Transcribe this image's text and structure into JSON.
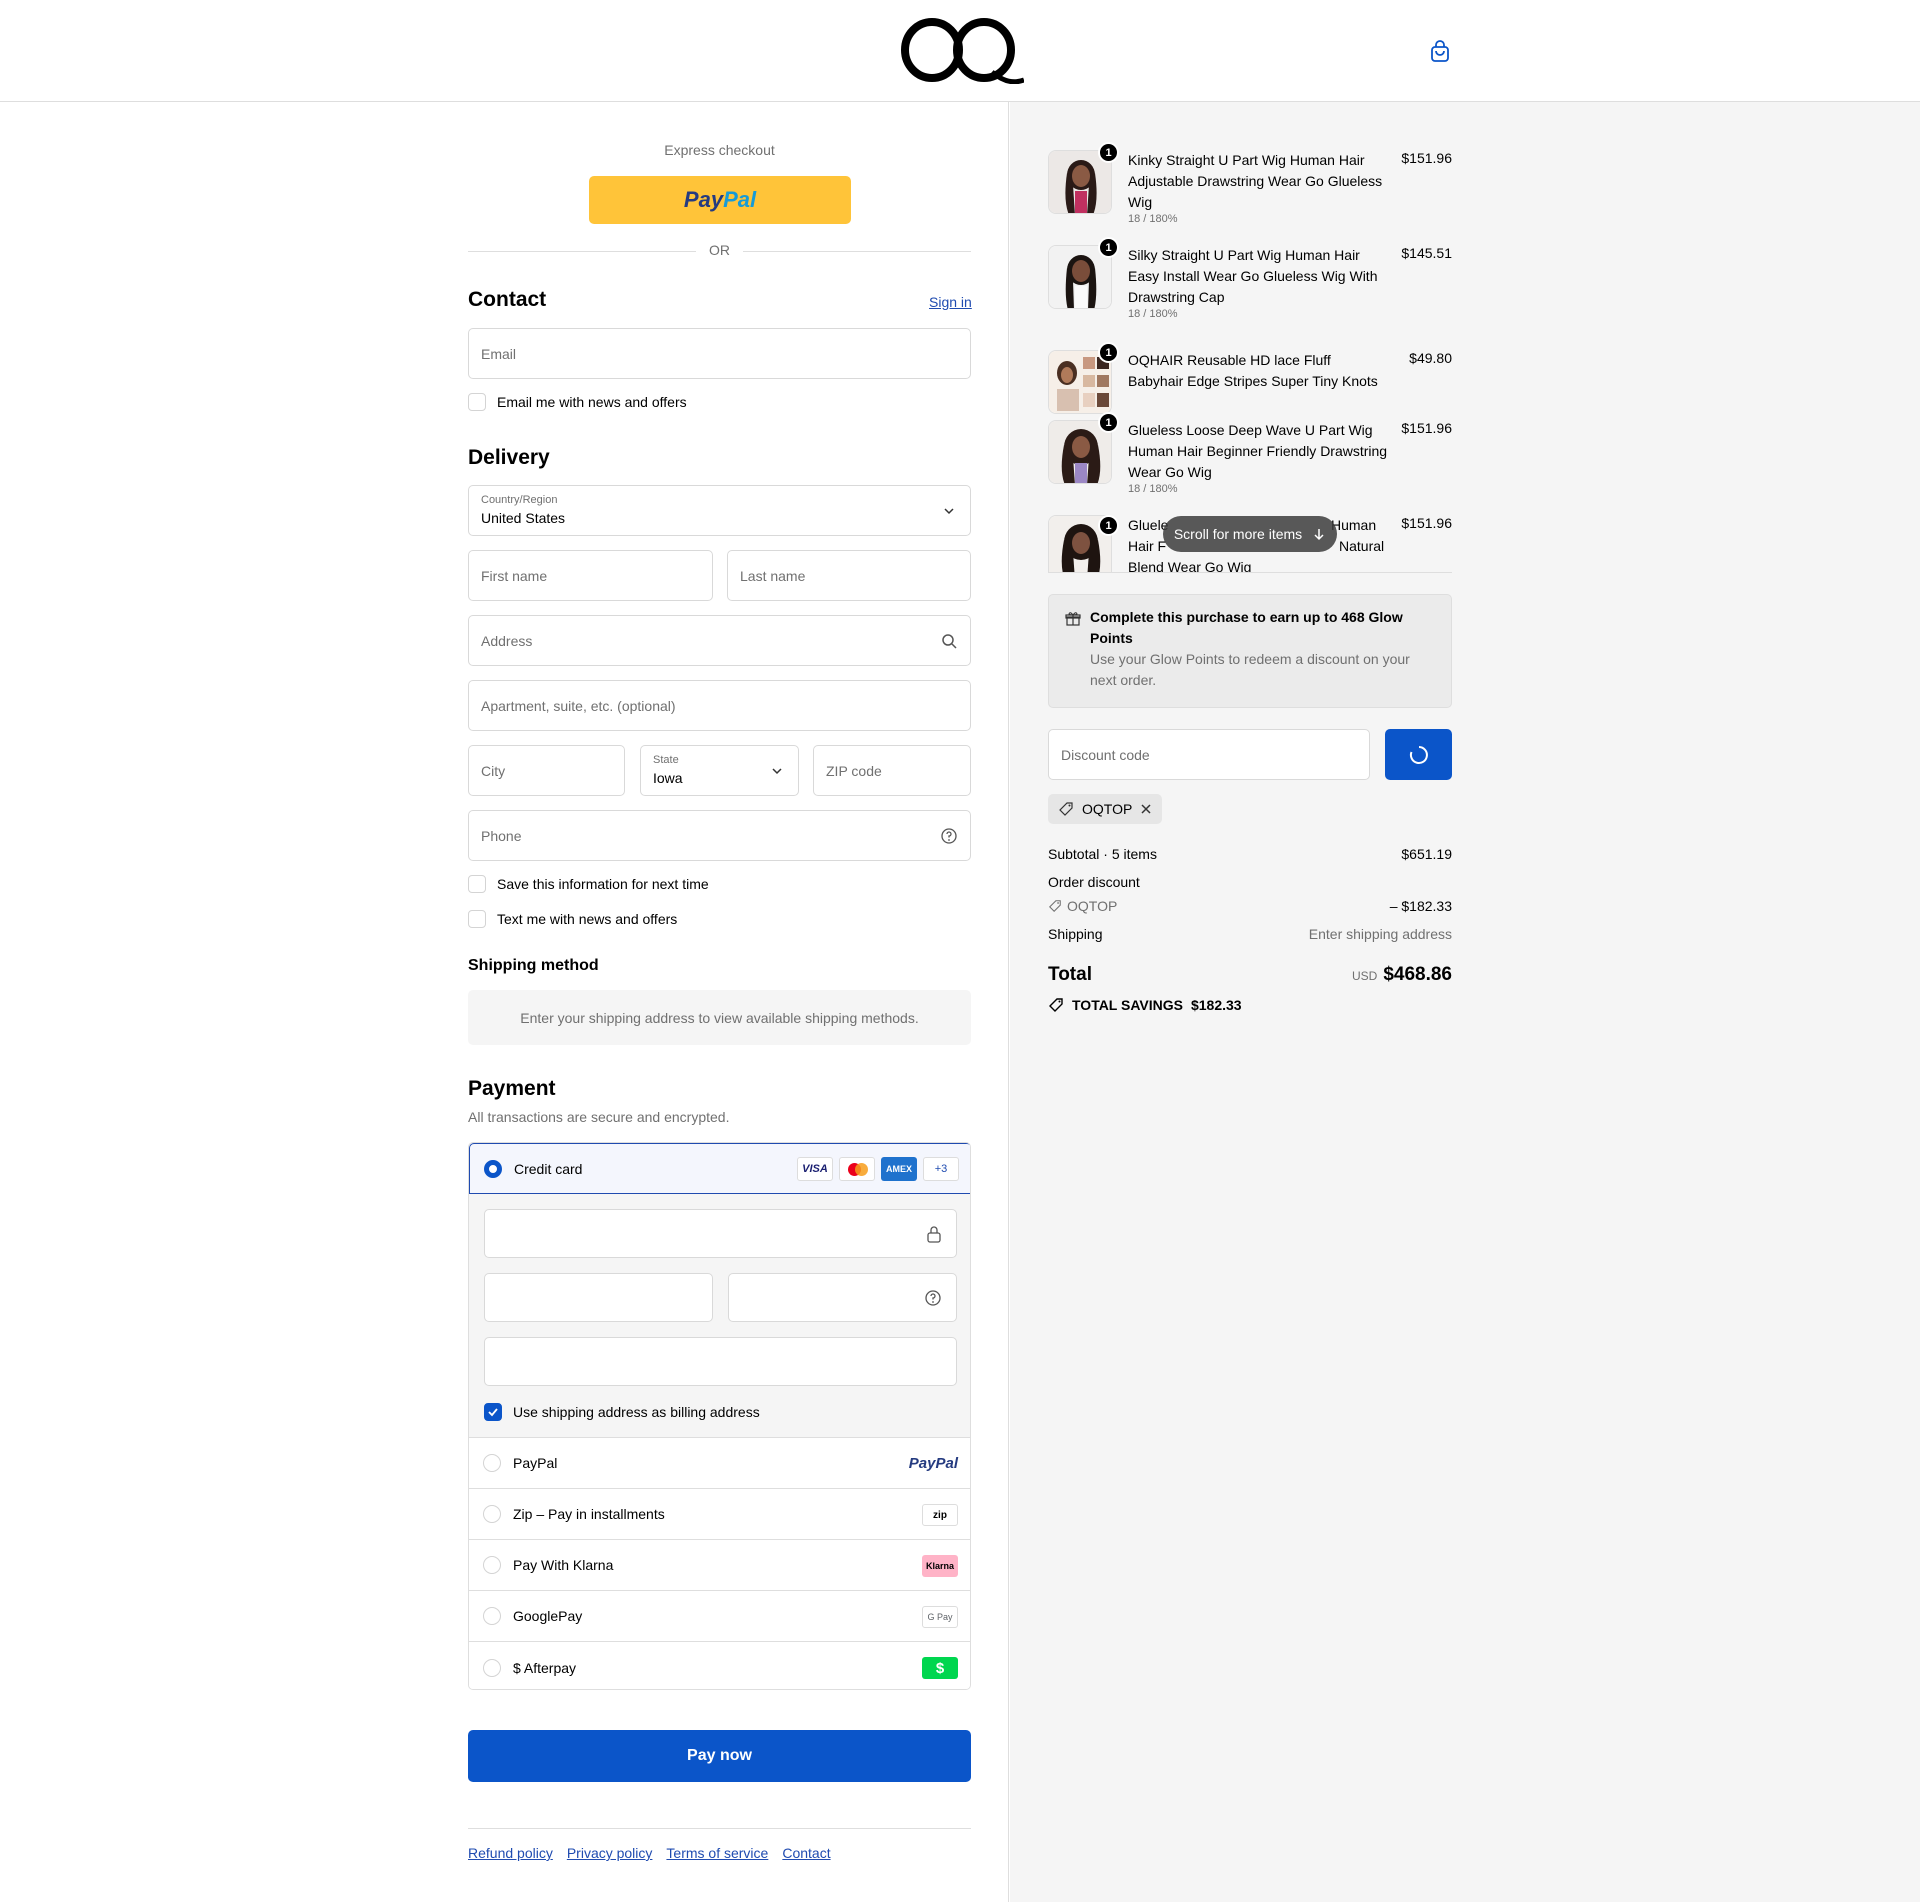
{
  "header": {
    "logo_text": "OQ",
    "cart_icon": "bag-icon"
  },
  "express": {
    "title": "Express checkout",
    "paypal_label_1": "Pay",
    "paypal_label_2": "Pal",
    "or": "OR"
  },
  "contact": {
    "title": "Contact",
    "sign_in": "Sign in",
    "email_placeholder": "Email",
    "news_label": "Email me with news and offers"
  },
  "delivery": {
    "title": "Delivery",
    "country_label": "Country/Region",
    "country_value": "United States",
    "first_name": "First name",
    "last_name": "Last name",
    "address": "Address",
    "apartment": "Apartment, suite, etc. (optional)",
    "city": "City",
    "state_label": "State",
    "state_value": "Iowa",
    "zip": "ZIP code",
    "phone": "Phone",
    "save_info": "Save this information for next time",
    "text_news": "Text me with news and offers"
  },
  "shipping": {
    "title": "Shipping method",
    "message": "Enter your shipping address to view available shipping methods."
  },
  "payment": {
    "title": "Payment",
    "subtitle": "All transactions are secure and encrypted.",
    "credit_card": "Credit card",
    "card_brands": [
      "VISA",
      "AMEX",
      "+3"
    ],
    "billing_label": "Use shipping address as billing address",
    "options": [
      {
        "label": "PayPal",
        "logo": "PayPal"
      },
      {
        "label": "Zip – Pay in installments",
        "logo": "zip"
      },
      {
        "label": "Pay With Klarna",
        "logo": "Klarna"
      },
      {
        "label": "GooglePay",
        "logo": "G Pay"
      },
      {
        "label": "$ Afterpay",
        "logo": "$"
      }
    ],
    "pay_now": "Pay now"
  },
  "footer": {
    "links": [
      "Refund policy",
      "Privacy policy",
      "Terms of service",
      "Contact"
    ]
  },
  "cart": {
    "items": [
      {
        "qty": "1",
        "name": "Kinky Straight U Part Wig Human Hair Adjustable Drawstring Wear Go Glueless Wig",
        "variant": "18 / 180%",
        "price": "$151.96"
      },
      {
        "qty": "1",
        "name": "Silky Straight U Part Wig Human Hair Easy Install Wear Go Glueless Wig With Drawstring Cap",
        "variant": "18 / 180%",
        "price": "$145.51"
      },
      {
        "qty": "1",
        "name": "OQHAIR Reusable HD lace Fluff Babyhair Edge Stripes Super Tiny Knots",
        "variant": "",
        "price": "$49.80"
      },
      {
        "qty": "1",
        "name": "Glueless Loose Deep Wave U Part Wig Human Hair Beginner Friendly Drawstring Wear Go Wig",
        "variant": "18 / 180%",
        "price": "$151.96"
      },
      {
        "qty": "1",
        "name_1": "Gluele",
        "name_2": "Human",
        "name_3": "Hair F",
        "name_4": "Natural",
        "name_5": "Blend Wear Go Wig",
        "price": "$151.96"
      }
    ],
    "scroll_pill": "Scroll for more items"
  },
  "glow": {
    "title": "Complete this purchase to earn up to 468 Glow Points",
    "body": "Use your Glow Points to redeem a discount on your next order."
  },
  "discount": {
    "placeholder": "Discount code",
    "code": "OQTOP"
  },
  "summary": {
    "subtotal_label": "Subtotal · 5 items",
    "subtotal_value": "$651.19",
    "order_discount_label": "Order discount",
    "discount_code": "OQTOP",
    "discount_value": "– $182.33",
    "shipping_label": "Shipping",
    "shipping_value": "Enter shipping address",
    "total_label": "Total",
    "currency": "USD",
    "total_value": "$468.86",
    "savings_label": "TOTAL SAVINGS",
    "savings_value": "$182.33"
  },
  "colors": {
    "accent": "#0b55c9",
    "paypal_yellow": "#ffc439",
    "link": "#1f4bb0"
  }
}
